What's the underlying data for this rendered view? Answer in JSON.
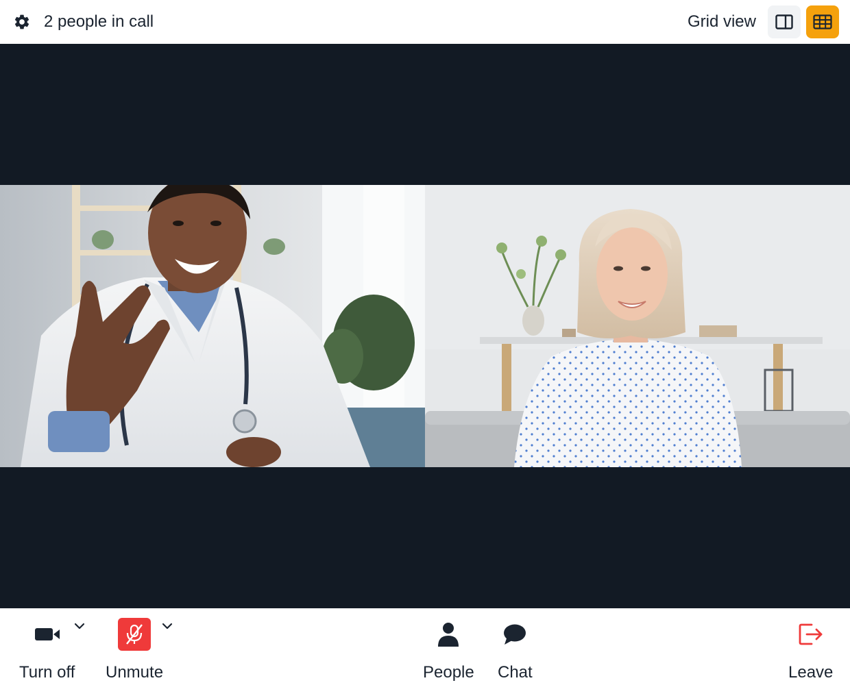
{
  "header": {
    "participants_text": "2 people in call",
    "view_label": "Grid view",
    "settings_icon": "gear-icon",
    "sidebar_view_icon": "sidebar-layout-icon",
    "grid_view_icon": "grid-layout-icon",
    "active_view_color": "#f5a10d"
  },
  "stage": {
    "background": "#121a24",
    "participants": [
      {
        "id": "participant-1",
        "description_icon": "video-feed"
      },
      {
        "id": "participant-2",
        "description_icon": "video-feed"
      }
    ]
  },
  "controls": {
    "camera_label": "Turn off",
    "camera_icon": "video-camera-icon",
    "mic_label": "Unmute",
    "mic_icon": "mic-off-icon",
    "mic_muted_color": "#ef3a3a",
    "people_label": "People",
    "people_icon": "person-icon",
    "chat_label": "Chat",
    "chat_icon": "chat-bubble-icon",
    "leave_label": "Leave",
    "leave_icon": "leave-icon",
    "leave_color": "#ef3a3a"
  }
}
